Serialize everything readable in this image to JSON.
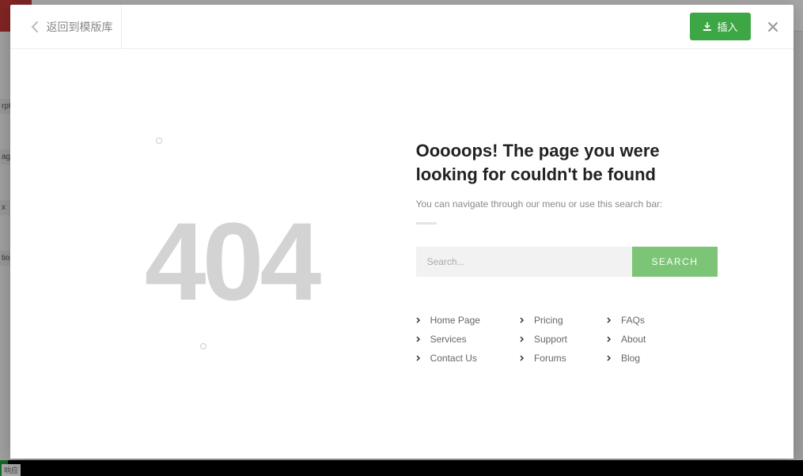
{
  "background": {
    "sidebar_items": [
      "rpt",
      "age:",
      "x",
      "tion"
    ],
    "bottom_text": "响应"
  },
  "modal": {
    "back_label": "返回到模版库",
    "insert_label": "插入"
  },
  "error": {
    "code": "404",
    "title": "Ooooops! The page you were looking for couldn't be found",
    "subtitle": "You can navigate through our menu or use this search bar:",
    "search_placeholder": "Search...",
    "search_button": "SEARCH",
    "links_col1": [
      "Home Page",
      "Services",
      "Contact Us"
    ],
    "links_col2": [
      "Pricing",
      "Support",
      "Forums"
    ],
    "links_col3": [
      "FAQs",
      "About",
      "Blog"
    ]
  }
}
